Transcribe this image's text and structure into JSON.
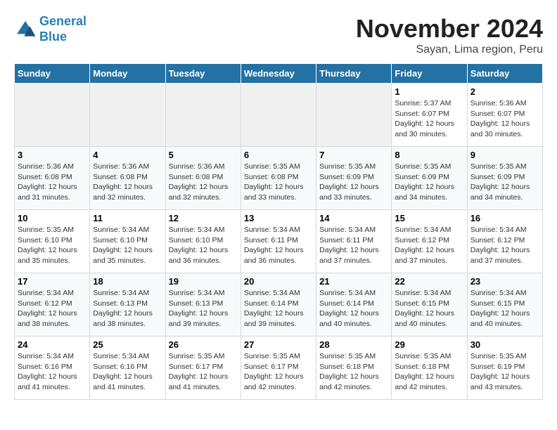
{
  "logo": {
    "line1": "General",
    "line2": "Blue"
  },
  "title": "November 2024",
  "subtitle": "Sayan, Lima region, Peru",
  "headers": [
    "Sunday",
    "Monday",
    "Tuesday",
    "Wednesday",
    "Thursday",
    "Friday",
    "Saturday"
  ],
  "weeks": [
    [
      {
        "day": "",
        "info": ""
      },
      {
        "day": "",
        "info": ""
      },
      {
        "day": "",
        "info": ""
      },
      {
        "day": "",
        "info": ""
      },
      {
        "day": "",
        "info": ""
      },
      {
        "day": "1",
        "info": "Sunrise: 5:37 AM\nSunset: 6:07 PM\nDaylight: 12 hours and 30 minutes."
      },
      {
        "day": "2",
        "info": "Sunrise: 5:36 AM\nSunset: 6:07 PM\nDaylight: 12 hours and 30 minutes."
      }
    ],
    [
      {
        "day": "3",
        "info": "Sunrise: 5:36 AM\nSunset: 6:08 PM\nDaylight: 12 hours and 31 minutes."
      },
      {
        "day": "4",
        "info": "Sunrise: 5:36 AM\nSunset: 6:08 PM\nDaylight: 12 hours and 32 minutes."
      },
      {
        "day": "5",
        "info": "Sunrise: 5:36 AM\nSunset: 6:08 PM\nDaylight: 12 hours and 32 minutes."
      },
      {
        "day": "6",
        "info": "Sunrise: 5:35 AM\nSunset: 6:08 PM\nDaylight: 12 hours and 33 minutes."
      },
      {
        "day": "7",
        "info": "Sunrise: 5:35 AM\nSunset: 6:09 PM\nDaylight: 12 hours and 33 minutes."
      },
      {
        "day": "8",
        "info": "Sunrise: 5:35 AM\nSunset: 6:09 PM\nDaylight: 12 hours and 34 minutes."
      },
      {
        "day": "9",
        "info": "Sunrise: 5:35 AM\nSunset: 6:09 PM\nDaylight: 12 hours and 34 minutes."
      }
    ],
    [
      {
        "day": "10",
        "info": "Sunrise: 5:35 AM\nSunset: 6:10 PM\nDaylight: 12 hours and 35 minutes."
      },
      {
        "day": "11",
        "info": "Sunrise: 5:34 AM\nSunset: 6:10 PM\nDaylight: 12 hours and 35 minutes."
      },
      {
        "day": "12",
        "info": "Sunrise: 5:34 AM\nSunset: 6:10 PM\nDaylight: 12 hours and 36 minutes."
      },
      {
        "day": "13",
        "info": "Sunrise: 5:34 AM\nSunset: 6:11 PM\nDaylight: 12 hours and 36 minutes."
      },
      {
        "day": "14",
        "info": "Sunrise: 5:34 AM\nSunset: 6:11 PM\nDaylight: 12 hours and 37 minutes."
      },
      {
        "day": "15",
        "info": "Sunrise: 5:34 AM\nSunset: 6:12 PM\nDaylight: 12 hours and 37 minutes."
      },
      {
        "day": "16",
        "info": "Sunrise: 5:34 AM\nSunset: 6:12 PM\nDaylight: 12 hours and 37 minutes."
      }
    ],
    [
      {
        "day": "17",
        "info": "Sunrise: 5:34 AM\nSunset: 6:12 PM\nDaylight: 12 hours and 38 minutes."
      },
      {
        "day": "18",
        "info": "Sunrise: 5:34 AM\nSunset: 6:13 PM\nDaylight: 12 hours and 38 minutes."
      },
      {
        "day": "19",
        "info": "Sunrise: 5:34 AM\nSunset: 6:13 PM\nDaylight: 12 hours and 39 minutes."
      },
      {
        "day": "20",
        "info": "Sunrise: 5:34 AM\nSunset: 6:14 PM\nDaylight: 12 hours and 39 minutes."
      },
      {
        "day": "21",
        "info": "Sunrise: 5:34 AM\nSunset: 6:14 PM\nDaylight: 12 hours and 40 minutes."
      },
      {
        "day": "22",
        "info": "Sunrise: 5:34 AM\nSunset: 6:15 PM\nDaylight: 12 hours and 40 minutes."
      },
      {
        "day": "23",
        "info": "Sunrise: 5:34 AM\nSunset: 6:15 PM\nDaylight: 12 hours and 40 minutes."
      }
    ],
    [
      {
        "day": "24",
        "info": "Sunrise: 5:34 AM\nSunset: 6:16 PM\nDaylight: 12 hours and 41 minutes."
      },
      {
        "day": "25",
        "info": "Sunrise: 5:34 AM\nSunset: 6:16 PM\nDaylight: 12 hours and 41 minutes."
      },
      {
        "day": "26",
        "info": "Sunrise: 5:35 AM\nSunset: 6:17 PM\nDaylight: 12 hours and 41 minutes."
      },
      {
        "day": "27",
        "info": "Sunrise: 5:35 AM\nSunset: 6:17 PM\nDaylight: 12 hours and 42 minutes."
      },
      {
        "day": "28",
        "info": "Sunrise: 5:35 AM\nSunset: 6:18 PM\nDaylight: 12 hours and 42 minutes."
      },
      {
        "day": "29",
        "info": "Sunrise: 5:35 AM\nSunset: 6:18 PM\nDaylight: 12 hours and 42 minutes."
      },
      {
        "day": "30",
        "info": "Sunrise: 5:35 AM\nSunset: 6:19 PM\nDaylight: 12 hours and 43 minutes."
      }
    ]
  ]
}
